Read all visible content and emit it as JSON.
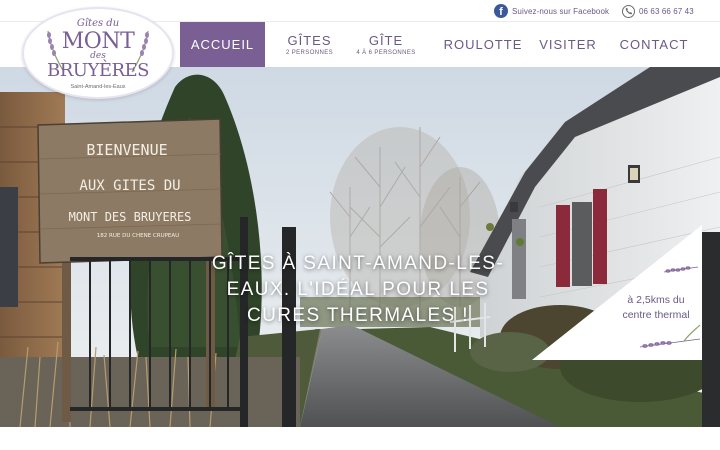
{
  "topbar": {
    "facebook_icon": "facebook-icon",
    "facebook_text": "Suivez-nous sur Facebook",
    "phone_icon": "phone-icon",
    "phone": "06 63 66 67 43"
  },
  "logo": {
    "line1": "Gîtes du",
    "line2": "MONT",
    "line3": "des",
    "line4": "BRUYÈRES",
    "town": "Saint-Amand-les-Eaux"
  },
  "nav": {
    "items": [
      {
        "label": "ACCUEIL",
        "sub": "",
        "active": true
      },
      {
        "label": "GÎTES",
        "sub": "2 PERSONNES",
        "active": false
      },
      {
        "label": "GÎTE",
        "sub": "4 À 6 PERSONNES",
        "active": false
      },
      {
        "label": "ROULOTTE",
        "sub": "",
        "active": false
      },
      {
        "label": "VISITER",
        "sub": "",
        "active": false
      },
      {
        "label": "CONTACT",
        "sub": "",
        "active": false
      }
    ]
  },
  "hero": {
    "headline": "GÎTES À SAINT-AMAND-LES-EAUX. L'IDÉAL POUR LES CURES THERMALES !",
    "sign": {
      "line1": "BIENVENUE",
      "line2": "AUX GITES DU",
      "line3": "MONT DES BRUYERES",
      "line4": "182 RUE DU CHENE CRUPEAU"
    },
    "badge": {
      "line1": "à 2,5kms du",
      "line2": "centre thermal"
    }
  },
  "colors": {
    "brand_purple": "#7a5f94",
    "text_purple": "#6a5a85",
    "facebook_blue": "#3b5998"
  }
}
